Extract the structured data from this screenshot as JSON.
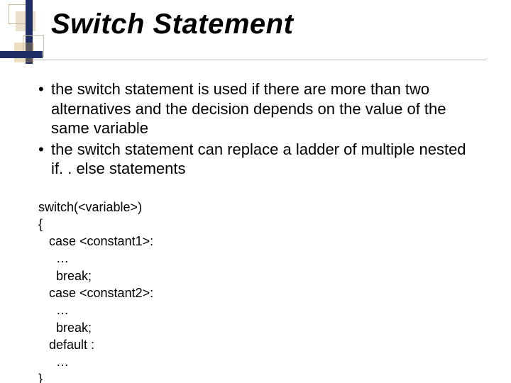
{
  "title": "Switch Statement",
  "bullets": [
    "the switch statement is used if there are more than two alternatives and the decision depends on the value of the same variable",
    "the switch statement can replace a ladder of multiple nested if. . else statements"
  ],
  "code": [
    "switch(<variable>)",
    "{",
    "   case <constant1>:",
    "     …",
    "     break;",
    "   case <constant2>:",
    "     …",
    "     break;",
    "   default :",
    "     …",
    "}"
  ]
}
